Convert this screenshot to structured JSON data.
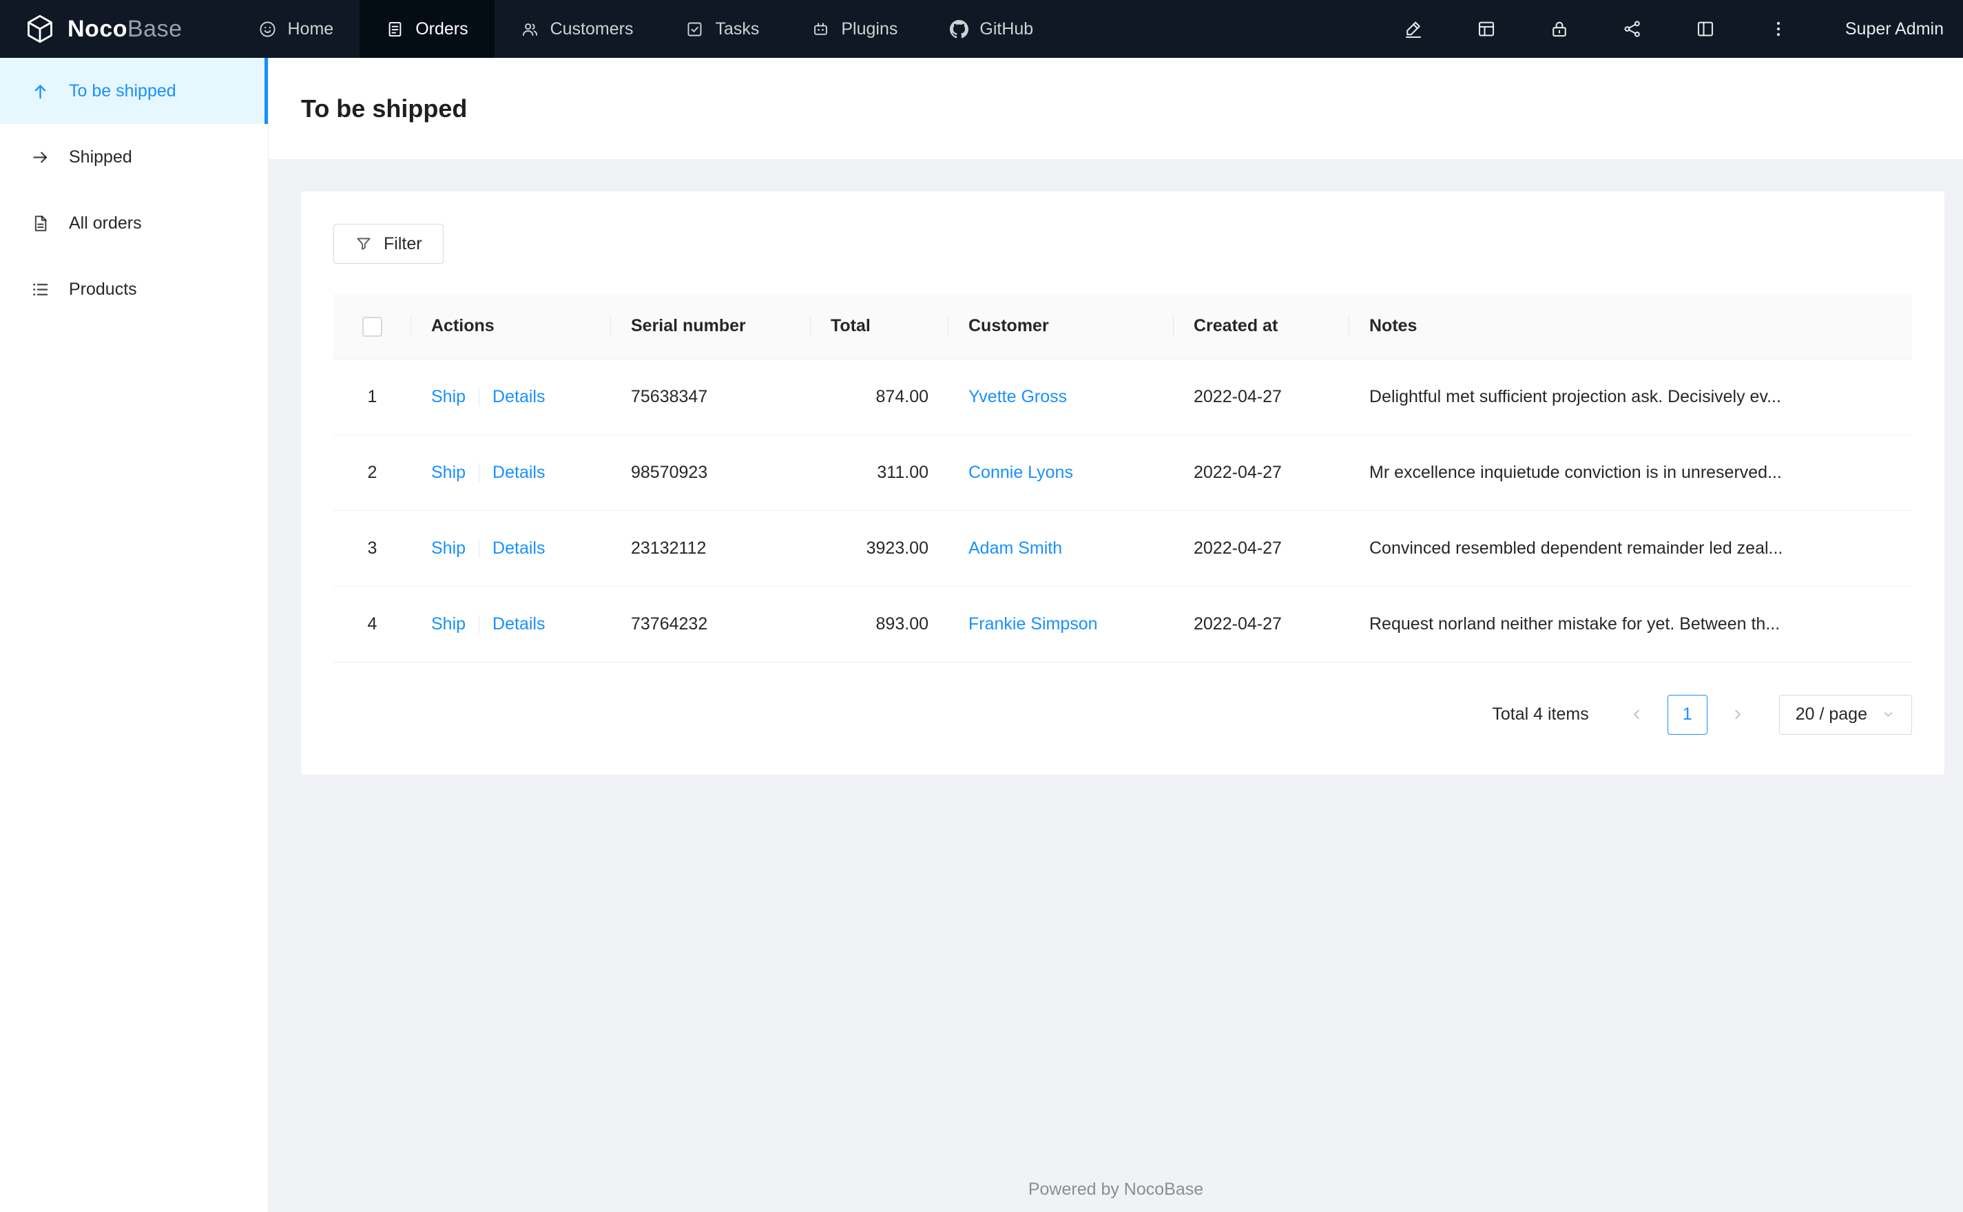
{
  "app": {
    "brand_bold": "Noco",
    "brand_light": "Base"
  },
  "topnav": {
    "items": [
      {
        "label": "Home"
      },
      {
        "label": "Orders"
      },
      {
        "label": "Customers"
      },
      {
        "label": "Tasks"
      },
      {
        "label": "Plugins"
      },
      {
        "label": "GitHub"
      }
    ],
    "user": "Super Admin"
  },
  "sidebar": {
    "items": [
      {
        "label": "To be shipped"
      },
      {
        "label": "Shipped"
      },
      {
        "label": "All orders"
      },
      {
        "label": "Products"
      }
    ]
  },
  "page": {
    "title": "To be shipped"
  },
  "toolbar": {
    "filter_label": "Filter"
  },
  "table": {
    "columns": [
      "Actions",
      "Serial number",
      "Total",
      "Customer",
      "Created at",
      "Notes"
    ],
    "action_labels": [
      "Ship",
      "Details"
    ],
    "rows": [
      {
        "index": "1",
        "serial": "75638347",
        "total": "874.00",
        "customer": "Yvette Gross",
        "created_at": "2022-04-27",
        "notes": "Delightful met sufficient projection ask. Decisively ev..."
      },
      {
        "index": "2",
        "serial": "98570923",
        "total": "311.00",
        "customer": "Connie Lyons",
        "created_at": "2022-04-27",
        "notes": "Mr excellence inquietude conviction is in unreserved..."
      },
      {
        "index": "3",
        "serial": "23132112",
        "total": "3923.00",
        "customer": "Adam Smith",
        "created_at": "2022-04-27",
        "notes": "Convinced resembled dependent remainder led zeal..."
      },
      {
        "index": "4",
        "serial": "73764232",
        "total": "893.00",
        "customer": "Frankie Simpson",
        "created_at": "2022-04-27",
        "notes": "Request norland neither mistake for yet. Between th..."
      }
    ]
  },
  "pagination": {
    "total_text": "Total 4 items",
    "current_page": "1",
    "page_size": "20 / page"
  },
  "footer": {
    "text": "Powered by NocoBase"
  },
  "colors": {
    "accent": "#1890ff",
    "link": "#1890ff",
    "navbar_bg": "#0f1824",
    "navbar_active_bg": "#040c14",
    "sidebar_active_bg": "#e6f7ff",
    "content_bg": "#f0f2f5",
    "table_header_bg": "#fafafa",
    "border": "#f0f0f0"
  }
}
